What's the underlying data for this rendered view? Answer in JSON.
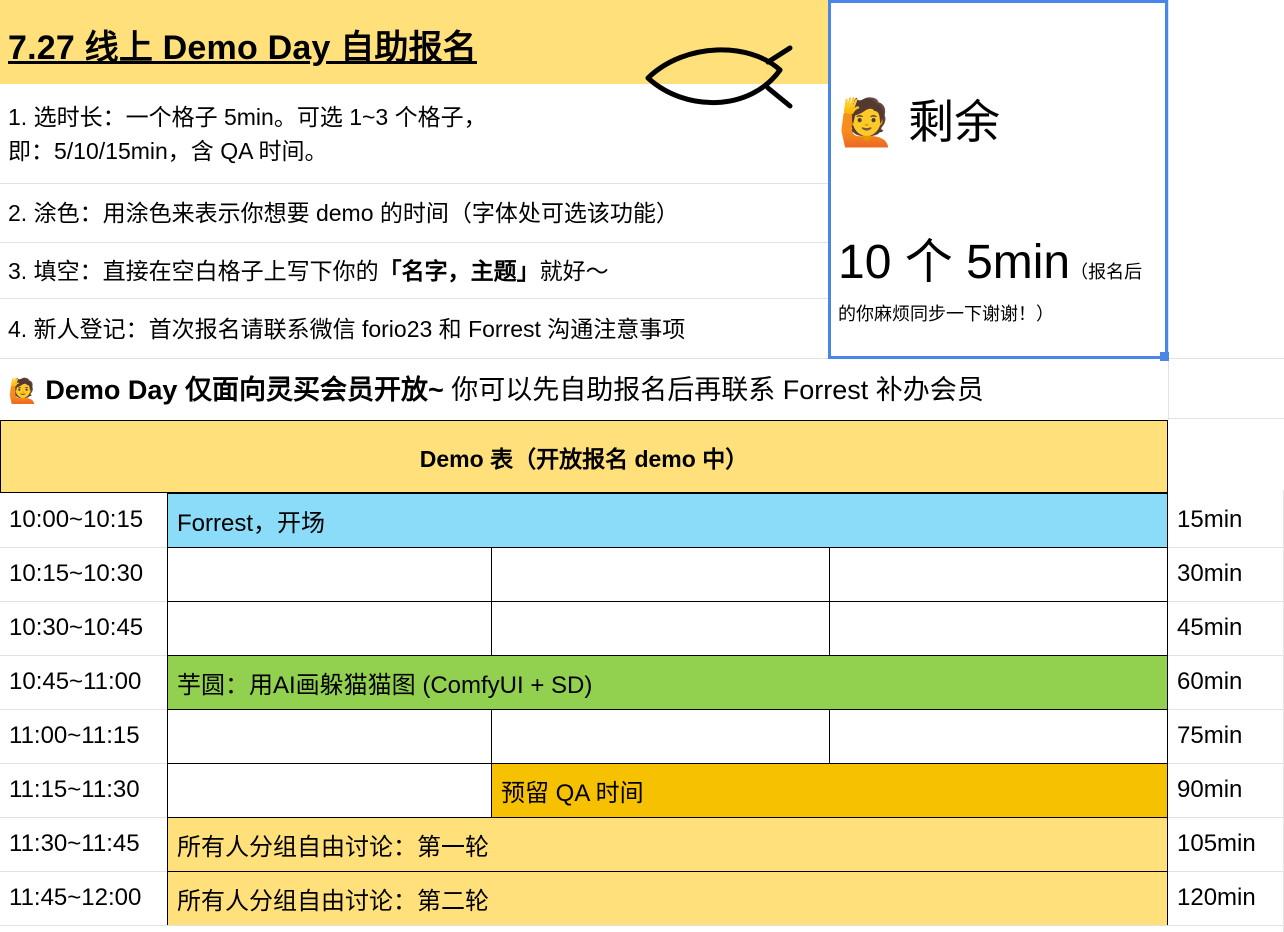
{
  "title": "7.27 线上 Demo Day 自助报名",
  "rules": {
    "r1_line1": "1. 选时长：一个格子 5min。可选 1~3 个格子，",
    "r1_line2": "即：5/10/15min，含 QA 时间。",
    "r2": "2. 涂色：用涂色来表示你想要 demo 的时间（字体处可选该功能）",
    "r3_prefix": "3. 填空：直接在空白格子上写下你的",
    "r3_bold": "「名字，主题」",
    "r3_suffix": "就好～",
    "r4": "4. 新人登记：首次报名请联系微信 forio23 和 Forrest 沟通注意事项"
  },
  "remaining": {
    "emoji": "🙋",
    "title": "剩余",
    "count": "10 个 5min",
    "note_part1": "（报名后",
    "note_part2": "的你麻烦同步一下谢谢！）"
  },
  "member": {
    "emoji": "🙋",
    "bold": "Demo Day 仅面向灵买会员开放~",
    "rest": " 你可以先自助报名后再联系 Forrest 补办会员"
  },
  "schedule_header": "Demo 表（开放报名 demo 中）",
  "schedule": [
    {
      "time": "10:00~10:15",
      "duration": "15min",
      "entry": "Forrest，开场"
    },
    {
      "time": "10:15~10:30",
      "duration": "30min"
    },
    {
      "time": "10:30~10:45",
      "duration": "45min"
    },
    {
      "time": "10:45~11:00",
      "duration": "60min",
      "entry": "芋圆：用AI画躲猫猫图 (ComfyUI + SD)"
    },
    {
      "time": "11:00~11:15",
      "duration": "75min"
    },
    {
      "time": "11:15~11:30",
      "duration": "90min",
      "entry": "预留 QA 时间"
    },
    {
      "time": "11:30~11:45",
      "duration": "105min",
      "entry": "所有人分组自由讨论：第一轮"
    },
    {
      "time": "11:45~12:00",
      "duration": "120min",
      "entry": "所有人分组自由讨论：第二轮"
    }
  ],
  "colors": {
    "yellow": "#ffe07a",
    "blue": "#8bdcf9",
    "green": "#92d050",
    "orange": "#f6c100",
    "selection": "#4a86e8"
  }
}
